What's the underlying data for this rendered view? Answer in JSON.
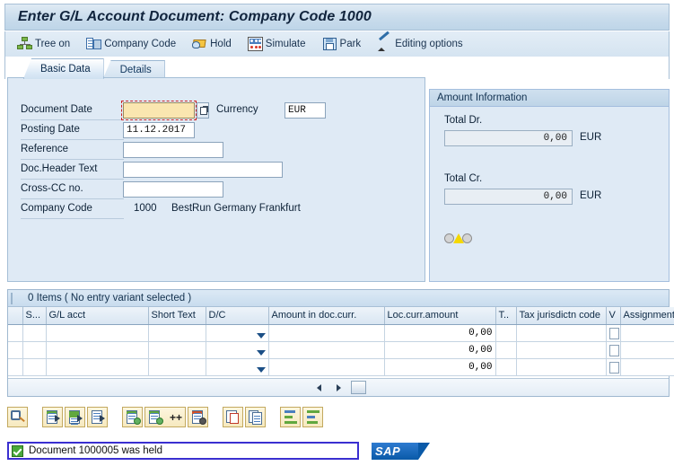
{
  "window": {
    "title": "Enter G/L Account Document: Company Code 1000"
  },
  "toolbar": {
    "buttons": [
      {
        "label": "Tree on",
        "icon": "tree-icon"
      },
      {
        "label": "Company Code",
        "icon": "company-code-icon"
      },
      {
        "label": "Hold",
        "icon": "hold-icon"
      },
      {
        "label": "Simulate",
        "icon": "simulate-icon"
      },
      {
        "label": "Park",
        "icon": "park-save-icon"
      },
      {
        "label": "Editing options",
        "icon": "pencil-edit-icon"
      }
    ]
  },
  "tabs": [
    {
      "label": "Basic Data",
      "active": true
    },
    {
      "label": "Details",
      "active": false
    }
  ],
  "basic_data": {
    "fields": [
      {
        "label": "Document Date",
        "value": "",
        "placeholder": ""
      },
      {
        "label": "Posting Date",
        "value": "11.12.2017",
        "placeholder": ""
      },
      {
        "label": "Reference",
        "value": "",
        "placeholder": ""
      },
      {
        "label": "Doc.Header Text",
        "value": "",
        "placeholder": ""
      },
      {
        "label": "Cross-CC no.",
        "value": "",
        "placeholder": ""
      },
      {
        "label": "Company Code",
        "value": "1000",
        "placeholder": ""
      }
    ],
    "currency_label": "Currency",
    "currency_value": "EUR",
    "company_code_value": "1000",
    "company_name": "BestRun Germany Frankfurt"
  },
  "amount_information": {
    "title": "Amount Information",
    "total_dr_label": "Total Dr.",
    "total_dr_value": "0,00",
    "total_dr_currency": "EUR",
    "total_cr_label": "Total Cr.",
    "total_cr_value": "0,00",
    "total_cr_currency": "EUR",
    "status_indicator": "yellow-warning-traffic-light"
  },
  "items_grid": {
    "title": "0 Items ( No entry variant selected )",
    "columns": [
      "S...",
      "G/L acct",
      "Short Text",
      "D/C",
      "Amount in doc.curr.",
      "Loc.curr.amount",
      "T..",
      "Tax jurisdictn code",
      "V",
      "Assignment"
    ],
    "rows": [
      {
        "sel": "",
        "gl_acct": "",
        "short_text": "",
        "dc": "",
        "amount_doc": "",
        "amount_loc": "0,00",
        "tax": "",
        "tax_jur": "",
        "v": "",
        "assignment": ""
      },
      {
        "sel": "",
        "gl_acct": "",
        "short_text": "",
        "dc": "",
        "amount_doc": "",
        "amount_loc": "0,00",
        "tax": "",
        "tax_jur": "",
        "v": "",
        "assignment": ""
      },
      {
        "sel": "",
        "gl_acct": "",
        "short_text": "",
        "dc": "",
        "amount_doc": "",
        "amount_loc": "0,00",
        "tax": "",
        "tax_jur": "",
        "v": "",
        "assignment": ""
      }
    ]
  },
  "bottom_toolbar": {
    "buttons": [
      {
        "name": "find-icon",
        "label": ""
      },
      {
        "name": "select-all-lines-icon",
        "label": ""
      },
      {
        "name": "select-block-icon",
        "label": ""
      },
      {
        "name": "deselect-lines-icon",
        "label": ""
      },
      {
        "name": "insert-line-icon",
        "label": ""
      },
      {
        "name": "insert-multiple-lines-icon",
        "label": "++"
      },
      {
        "name": "delete-line-icon",
        "label": ""
      },
      {
        "name": "cut-line-icon",
        "label": ""
      },
      {
        "name": "copy-line-icon",
        "label": ""
      },
      {
        "name": "sort-ascending-icon",
        "label": ""
      },
      {
        "name": "sort-descending-icon",
        "label": ""
      }
    ]
  },
  "status_bar": {
    "message": "Document 1000005 was held",
    "icon": "success-check-icon",
    "logo": "SAP"
  },
  "colors": {
    "title_bg": "#c9dcec",
    "panel_bg": "#dfeaf5",
    "focus_field": "#fae6b0",
    "focus_border": "#cc2222",
    "status_ok": "#49a93a",
    "status_box_border": "#3a2fd0",
    "sap_blue": "#0a5aa8",
    "warning_yellow": "#f5d800"
  }
}
